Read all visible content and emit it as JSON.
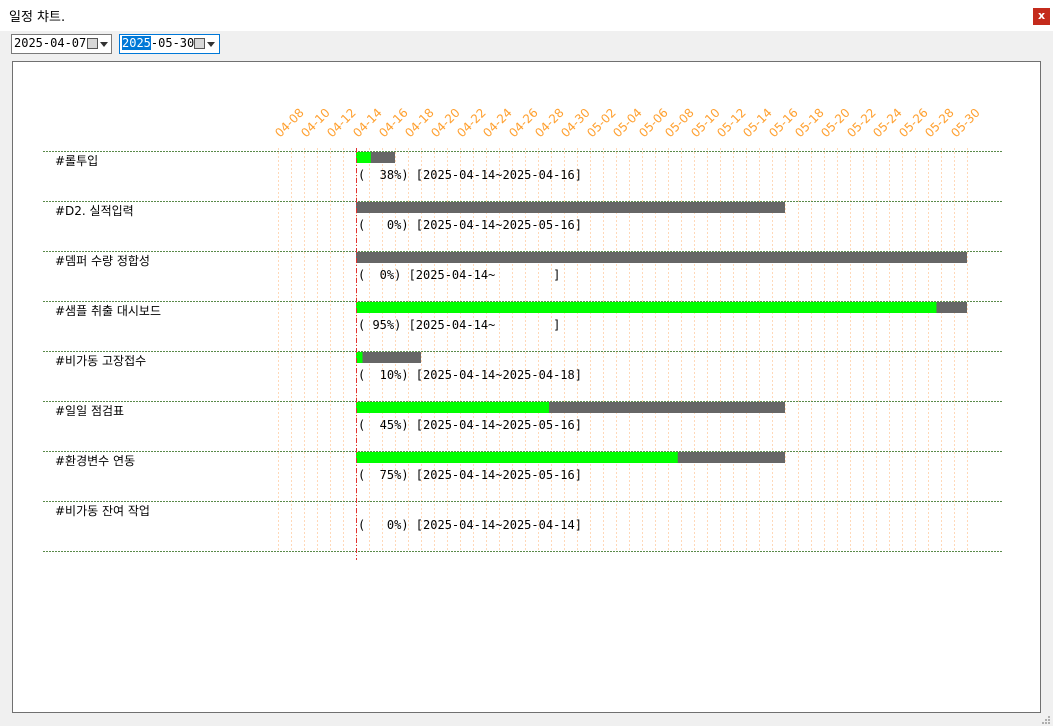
{
  "window": {
    "title": "일정 챠트.",
    "close_label": "x"
  },
  "filters": {
    "start_date": "2025-04-07",
    "end_date_selected_part": "2025",
    "end_date_rest": "-05-30"
  },
  "colors": {
    "progress": "#00ff00",
    "bar": "#666666",
    "today_line": "#e03030",
    "tick_label": "#ffa030"
  },
  "chart_data": {
    "type": "gantt",
    "x_tick_labels": [
      "04-08",
      "04-10",
      "04-12",
      "04-14",
      "04-16",
      "04-18",
      "04-20",
      "04-22",
      "04-24",
      "04-26",
      "04-28",
      "04-30",
      "05-02",
      "05-04",
      "05-06",
      "05-08",
      "05-10",
      "05-12",
      "05-14",
      "05-16",
      "05-18",
      "05-20",
      "05-22",
      "05-24",
      "05-26",
      "05-28",
      "05-30"
    ],
    "today": "2025-04-14",
    "tasks": [
      {
        "name": "#롤투입",
        "start": "2025-04-14",
        "end": "2025-04-16",
        "progress": 38,
        "label": "(  38%) [2025-04-14~2025-04-16]"
      },
      {
        "name": "#D2. 실적입력",
        "start": "2025-04-14",
        "end": "2025-05-16",
        "progress": 0,
        "label": "(   0%) [2025-04-14~2025-05-16]"
      },
      {
        "name": "#뎀퍼 수량 정합성",
        "start": "2025-04-14",
        "end": "2025-05-30",
        "progress": 0,
        "label": "(  0%) [2025-04-14~        ]"
      },
      {
        "name": "#샘플 취출 대시보드",
        "start": "2025-04-14",
        "end": "2025-05-30",
        "progress": 95,
        "label": "( 95%) [2025-04-14~        ]"
      },
      {
        "name": "#비가동 고장접수",
        "start": "2025-04-14",
        "end": "2025-04-18",
        "progress": 10,
        "label": "(  10%) [2025-04-14~2025-04-18]"
      },
      {
        "name": "#일일 점검표",
        "start": "2025-04-14",
        "end": "2025-05-16",
        "progress": 45,
        "label": "(  45%) [2025-04-14~2025-05-16]"
      },
      {
        "name": "#환경변수 연동",
        "start": "2025-04-14",
        "end": "2025-05-16",
        "progress": 75,
        "label": "(  75%) [2025-04-14~2025-05-16]"
      },
      {
        "name": "#비가동 잔여 작업",
        "start": "2025-04-14",
        "end": "2025-04-14",
        "progress": 0,
        "label": "(   0%) [2025-04-14~2025-04-14]"
      }
    ]
  }
}
